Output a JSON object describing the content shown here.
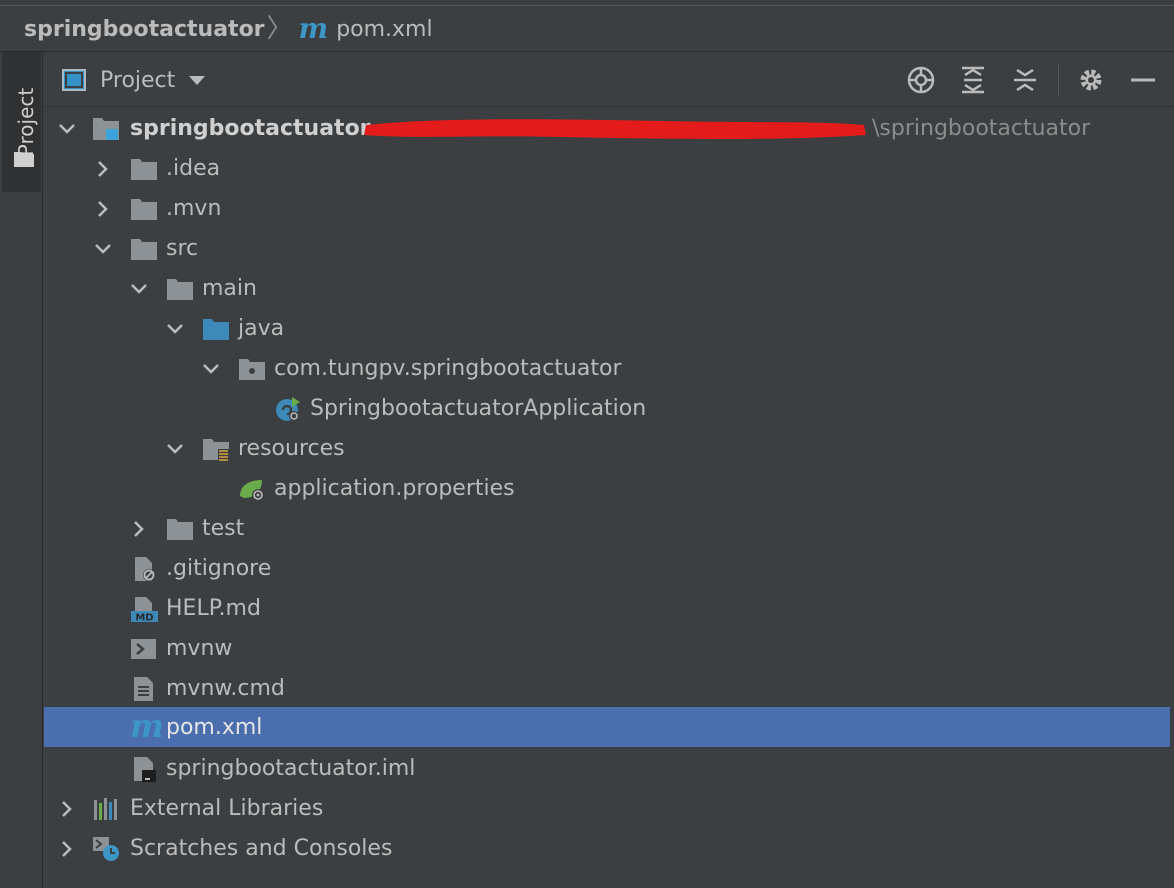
{
  "navbar": {
    "project": "springbootactuator",
    "separator": "〉",
    "file_icon": "m",
    "file": "pom.xml"
  },
  "stripe": {
    "tab_label": "Project"
  },
  "toolbar": {
    "view_label": "Project",
    "icons": [
      "locate-icon",
      "expand-all-icon",
      "collapse-all-icon",
      "gear-icon",
      "minimize-icon"
    ]
  },
  "tree": {
    "rows": [
      {
        "label": "springbootactuator",
        "path": "\\springbootactuator",
        "icon": "module-folder-icon",
        "state": "expanded"
      },
      {
        "label": ".idea",
        "icon": "folder-icon",
        "state": "collapsed"
      },
      {
        "label": ".mvn",
        "icon": "folder-icon",
        "state": "collapsed"
      },
      {
        "label": "src",
        "icon": "folder-icon",
        "state": "expanded"
      },
      {
        "label": "main",
        "icon": "folder-icon",
        "state": "expanded"
      },
      {
        "label": "java",
        "icon": "source-folder-icon",
        "state": "expanded"
      },
      {
        "label": "com.tungpv.springbootactuator",
        "icon": "package-icon",
        "state": "expanded"
      },
      {
        "label": "SpringbootactuatorApplication",
        "icon": "spring-class-icon"
      },
      {
        "label": "resources",
        "icon": "resources-folder-icon",
        "state": "expanded"
      },
      {
        "label": "application.properties",
        "icon": "spring-properties-icon"
      },
      {
        "label": "test",
        "icon": "folder-icon",
        "state": "collapsed"
      },
      {
        "label": ".gitignore",
        "icon": "ignore-file-icon"
      },
      {
        "label": "HELP.md",
        "icon": "markdown-icon",
        "icon_text": "MD"
      },
      {
        "label": "mvnw",
        "icon": "shell-script-icon"
      },
      {
        "label": "mvnw.cmd",
        "icon": "text-file-icon"
      },
      {
        "label": "pom.xml",
        "icon": "maven-icon",
        "icon_text": "m",
        "selected": true
      },
      {
        "label": "springbootactuator.iml",
        "icon": "iml-file-icon"
      },
      {
        "label": "External Libraries",
        "icon": "libraries-icon",
        "state": "collapsed"
      },
      {
        "label": "Scratches and Consoles",
        "icon": "scratches-icon",
        "state": "collapsed"
      }
    ]
  },
  "colors": {
    "background": "#3c3f41",
    "selection": "#4b6eaf",
    "text": "#bbbbbb",
    "folder": "#8c9296",
    "source_folder": "#3d8ab8",
    "maven_blue": "#3d96c8",
    "spring_green": "#6aab4a",
    "redaction": "#e31b1b"
  }
}
